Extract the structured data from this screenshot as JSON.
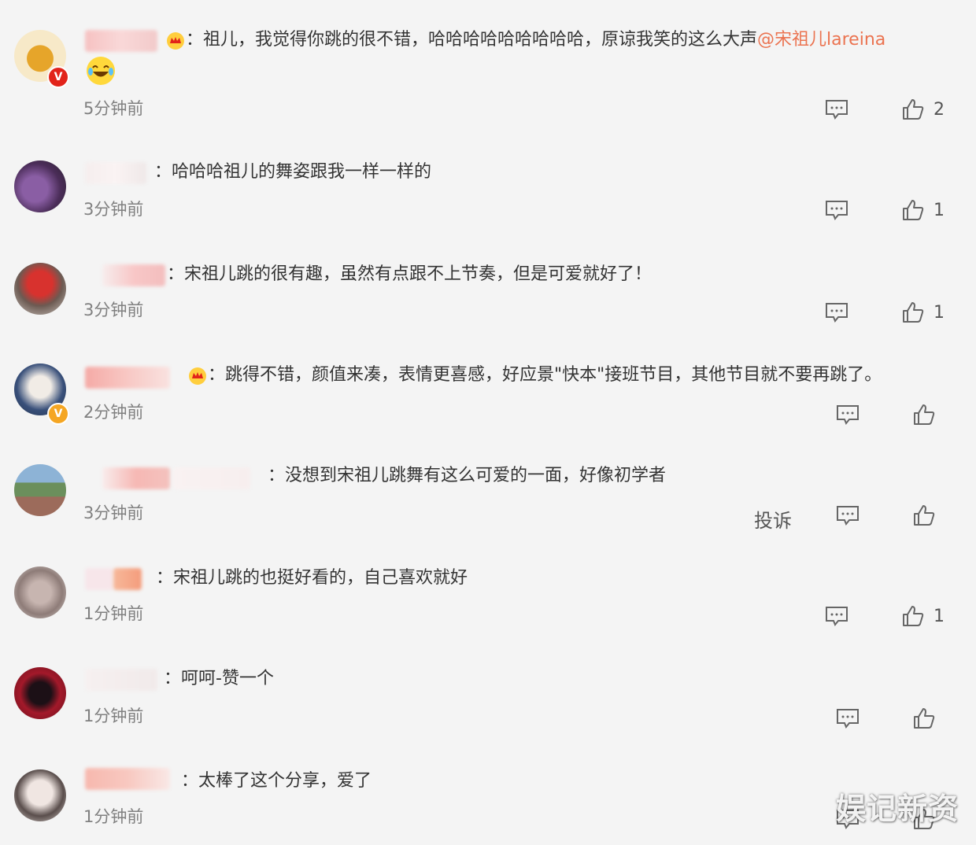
{
  "comments": [
    {
      "text": "：祖儿，我觉得你跳的很不错，哈哈哈哈哈哈哈哈哈，原谅我笑的这么大声",
      "mention": "@宋祖儿lareina",
      "time": "5分钟前",
      "likes": "2",
      "avatar_badge": "V",
      "emoji": "laughing-crying"
    },
    {
      "text": "：哈哈哈祖儿的舞姿跟我一样一样的",
      "time": "3分钟前",
      "likes": "1"
    },
    {
      "text": "：宋祖儿跳的很有趣，虽然有点跟不上节奏，但是可爱就好了！",
      "time": "3分钟前",
      "likes": "1"
    },
    {
      "text": "：跳得不错，颜值来凑，表情更喜感，好应景\"快本\"接班节目，其他节目就不要再跳了。",
      "time": "2分钟前",
      "likes": "",
      "avatar_badge": "V"
    },
    {
      "text": "：没想到宋祖儿跳舞有这么可爱的一面，好像初学者",
      "time": "3分钟前",
      "likes": "",
      "report_label": "投诉"
    },
    {
      "text": "：宋祖儿跳的也挺好看的，自己喜欢就好",
      "time": "1分钟前",
      "likes": "1"
    },
    {
      "text": "：呵呵-赞一个",
      "time": "1分钟前",
      "likes": ""
    },
    {
      "text": "：太棒了这个分享，爱了",
      "time": "1分钟前",
      "likes": ""
    }
  ],
  "watermark": "娱记新资",
  "colors": {
    "background": "#f4f4f4",
    "text": "#333333",
    "time": "#808080",
    "mention": "#eb7350",
    "icon": "#666666",
    "badge_red": "#e2231a",
    "badge_gold": "#f5a623"
  }
}
